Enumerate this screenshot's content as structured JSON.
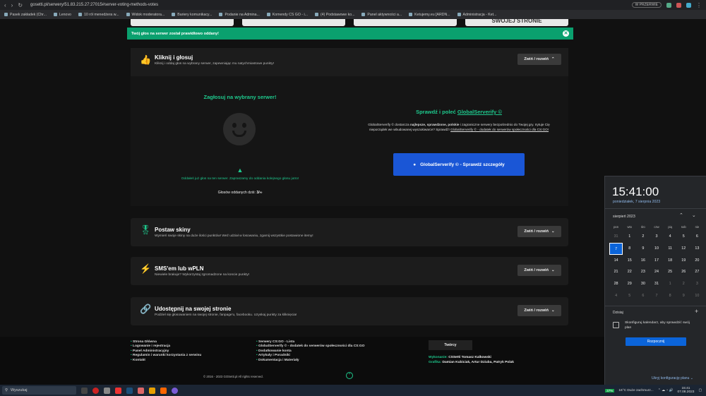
{
  "browser": {
    "url": "gosetti.pl/serwery/51.83.215.27:27015#server-voting-methods-votes",
    "incognito": "W PRZERWIE",
    "bookmarks": [
      "Pasek zakładek (Chr...",
      "Lenovo",
      "10 ról menedżera w...",
      "Widok moderatora...",
      "Bariery komunikacy...",
      "Podanie na Admina...",
      "Komendy CS GO - i...",
      "(4) Podstawowe ko...",
      "Panel aktywności a...",
      "Ketujemy.eu [ARDN...",
      "Administracja - Ket..."
    ]
  },
  "top_buttons": [
    "",
    "",
    "",
    "SWOJEJ STRONIE"
  ],
  "alert": {
    "text": "Twój głos na serwer został prawidłowo oddany!",
    "close": "✕"
  },
  "vote": {
    "title": "Kliknij i głosuj",
    "subtitle": "Kliknij i oddaj głos na wybrany serwer, zapewniając mu natychmiastowe punkty!",
    "toggle": "Zwiń / rozwiń",
    "heading": "Zagłosuj na wybrany serwer!",
    "warn": "Oddałeś już głos na ten serwer. Zapraszamy do oddania kolejnego głosu jutro!",
    "count_label": "Głosów oddanych dziś:",
    "count": "3/∞",
    "gs_title": "Sprawdź i poleć",
    "gs_link": "GlobalServerify ©",
    "gs_desc1": "GlobalServerify © dostarcza",
    "gs_b1": "najlepsze, sprawdzone, polskie",
    "gs_desc2": "i zagraniczne serwery bezpośrednio do Twojej gry. Irytuje Cię nieporządek we wbudowanej wyszukiwarce? Sprawdź!",
    "gs_link2": "GlobalServerify © - dodatek do serwerów społeczności dla CS:GO!",
    "gs_btn": "GlobalServerify © - Sprawdź szczegóły"
  },
  "sections": [
    {
      "title": "Postaw skiny",
      "subtitle": "Wymień swoje skiny na duże ilości punktów! Weź udział w losowaniu, zgarnij wszystkie postawione itemy!",
      "toggle": "Zwiń / rozwiń"
    },
    {
      "title": "SMS'em lub wPLN",
      "subtitle": "Niewiele brakuje? Wykorzystaj zgromadzone na koncie punkty!",
      "toggle": "Zwiń / rozwiń"
    },
    {
      "title": "Udostępnij na swojej stronie",
      "subtitle": "Podziel się głosowaniem na swojej stronie, fanpage'u, facebooku. Uzyskaj punkty za kliknięcia!",
      "toggle": "Zwiń / rozwiń"
    }
  ],
  "footer": {
    "col1": [
      "Strona Główna",
      "Logowanie i rejestracja",
      "Panel Administracyjny",
      "Regulamin i warunki korzystania z serwisu",
      "Kontakt"
    ],
    "col2": [
      "Serwery CS:GO - Lista",
      "GlobalServerify © - dodatek do serwerów społeczności dla CS:GO",
      "Dodatkowanie konta",
      "Artykuły i Poradniki",
      "Dokumentacja i Materiały"
    ],
    "authors": "Twórcy",
    "made_label": "Wykonanie:",
    "made": "CSSetti Tomasz Kalkowski",
    "graphic_label": "Grafika:",
    "graphic": "Damian Kubiciak, Artur Dziuba, Patryk Polak",
    "copyright": "© 2016 - 2023 GOSetti.pl All rights reserved."
  },
  "taskbar": {
    "search": "Wyszukaj",
    "battery": "37%",
    "weather": "16°C  Duże zachmurz...",
    "time": "15:41",
    "date": "07.08.2023"
  },
  "calendar": {
    "time": "15:41:00",
    "date": "poniedziałek, 7 sierpnia 2023",
    "month": "sierpień 2023",
    "weekdays": [
      "pon",
      "wto",
      "śro",
      "czw",
      "pią",
      "sob",
      "nie"
    ],
    "days": [
      "31",
      "1",
      "2",
      "3",
      "4",
      "5",
      "6",
      "7",
      "8",
      "9",
      "10",
      "11",
      "12",
      "13",
      "14",
      "15",
      "16",
      "17",
      "18",
      "19",
      "20",
      "21",
      "22",
      "23",
      "24",
      "25",
      "26",
      "27",
      "28",
      "29",
      "30",
      "31",
      "1",
      "2",
      "3",
      "4",
      "5",
      "6",
      "7",
      "8",
      "9",
      "10"
    ],
    "today_label": "Dzisiaj",
    "event": "Skonfiguruj kalendarz, aby sprawdzić swój plan",
    "connect": "Rozpocznij",
    "hide": "Ukryj konfigurację planu"
  }
}
